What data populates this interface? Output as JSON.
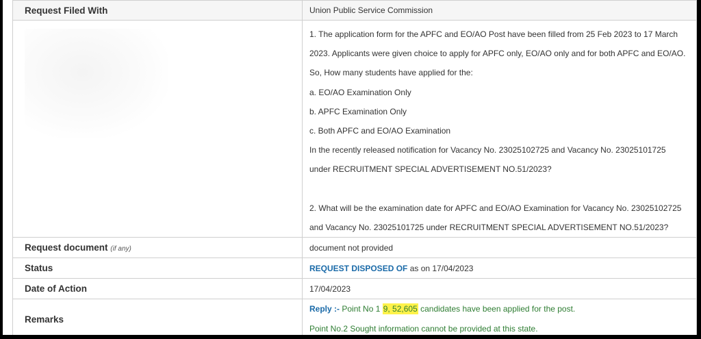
{
  "rows": {
    "filed": {
      "label": "Request Filed With",
      "value": "Union Public Service Commission"
    },
    "question": {
      "lines": [
        "1. The application form for the APFC and EO/AO Post have been filled from 25 Feb 2023 to 17 March",
        "2023. Applicants were given choice to apply for APFC only, EO/AO only and for both APFC and EO/AO.",
        "So, How many students have applied for the:",
        "a. EO/AO Examination Only",
        "b. APFC Examination Only",
        "c. Both APFC and EO/AO Examination",
        "In the recently released notification for Vacancy No. 23025102725 and Vacancy No. 23025101725",
        "under RECRUITMENT SPECIAL ADVERTISEMENT NO.51/2023?"
      ],
      "lines2": [
        "2. What will be the examination date for APFC and EO/AO Examination for Vacancy No. 23025102725",
        "and Vacancy No. 23025101725 under RECRUITMENT SPECIAL ADVERTISEMENT NO.51/2023?"
      ]
    },
    "document": {
      "label": "Request document",
      "label_note": "(if any)",
      "value": "document not provided"
    },
    "status": {
      "label": "Status",
      "status_text": "REQUEST DISPOSED OF",
      "suffix": " as on 17/04/2023"
    },
    "date": {
      "label": "Date of Action",
      "value": "17/04/2023"
    },
    "remarks": {
      "label": "Remarks",
      "reply_label": "Reply :-",
      "line1_prefix": " Point No 1 ",
      "highlight": "9, 52,605",
      "line1_suffix": " candidates have been applied for the post.",
      "line2": "Point No.2 Sought information cannot be provided at this state."
    }
  },
  "colors": {
    "status_blue": "#1a6aa8",
    "remark_green": "#2e7d32",
    "highlight": "#fff24a"
  }
}
